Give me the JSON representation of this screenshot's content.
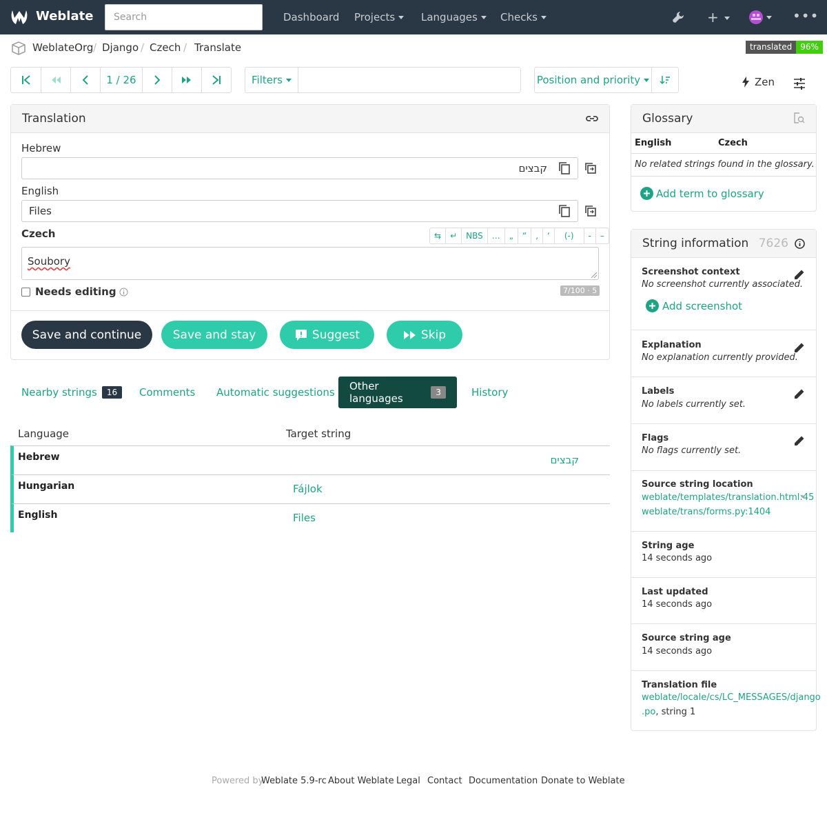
{
  "nav": {
    "brand": "Weblate",
    "search_placeholder": "Search",
    "links": [
      "Dashboard",
      "Projects",
      "Languages",
      "Checks"
    ]
  },
  "breadcrumb": [
    "WeblateOrg",
    "Django",
    "Czech",
    "Translate"
  ],
  "badge": {
    "label": "translated",
    "value": "96%"
  },
  "toolbar": {
    "position": "1 / 26",
    "filters_label": "Filters",
    "sort_label": "Position and priority",
    "zen_label": "Zen"
  },
  "translation": {
    "title": "Translation",
    "hebrew_label": "Hebrew",
    "hebrew_value": "קבצים",
    "english_label": "English",
    "english_value": "Files",
    "czech_label": "Czech",
    "czech_value": "Soubory",
    "char_buttons": [
      "⇆",
      "↵",
      "NBS",
      "…",
      "„",
      "“",
      ",",
      "‘",
      "(-)",
      "-",
      "–"
    ],
    "needs_editing_label": "Needs editing",
    "counter": "7/100 · 5",
    "buttons": {
      "save_continue": "Save and continue",
      "save_stay": "Save and stay",
      "suggest": "Suggest",
      "skip": "Skip"
    }
  },
  "tabs": [
    {
      "label": "Nearby strings",
      "badge": "16"
    },
    {
      "label": "Comments",
      "badge": ""
    },
    {
      "label": "Automatic suggestions",
      "badge": ""
    },
    {
      "label": "Other languages",
      "badge": "3"
    },
    {
      "label": "History",
      "badge": ""
    }
  ],
  "other_languages": {
    "headers": [
      "Language",
      "Target string"
    ],
    "rows": [
      {
        "language": "Hebrew",
        "target": "קבצים"
      },
      {
        "language": "Hungarian",
        "target": "Fájlok"
      },
      {
        "language": "English",
        "target": "Files"
      }
    ]
  },
  "glossary": {
    "title": "Glossary",
    "col_source": "English",
    "col_target": "Czech",
    "empty_text": "No related strings found in the glossary.",
    "add_label": "Add term to glossary"
  },
  "string_info": {
    "title": "String information",
    "id": "7626",
    "screenshot_title": "Screenshot context",
    "screenshot_text": "No screenshot currently associated.",
    "add_screenshot": "Add screenshot",
    "explanation_title": "Explanation",
    "explanation_text": "No explanation currently provided.",
    "labels_title": "Labels",
    "labels_text": "No labels currently set.",
    "flags_title": "Flags",
    "flags_text": "No flags currently set.",
    "location_title": "Source string location",
    "location_1": "weblate/templates/translation.html:45",
    "location_2": "weblate/trans/forms.py:1404",
    "age_title": "String age",
    "age_text": "14 seconds ago",
    "updated_title": "Last updated",
    "updated_text": "14 seconds ago",
    "source_age_title": "Source string age",
    "source_age_text": "14 seconds ago",
    "file_title": "Translation file",
    "file_link_1": "weblate/locale/cs/LC_MESSAGES/django",
    "file_link_2": ".po",
    "file_suffix": ", string 1"
  },
  "footer": {
    "powered_by": "Powered by",
    "version": "Weblate 5.9-rc",
    "links": [
      "About Weblate",
      "Legal",
      "Contact",
      "Documentation",
      "Donate to Weblate"
    ]
  },
  "colors": {
    "navbar": "#2a3744",
    "accent": "#2eccaa",
    "dark_button": "#2a3744",
    "active_tab": "#124a41"
  }
}
